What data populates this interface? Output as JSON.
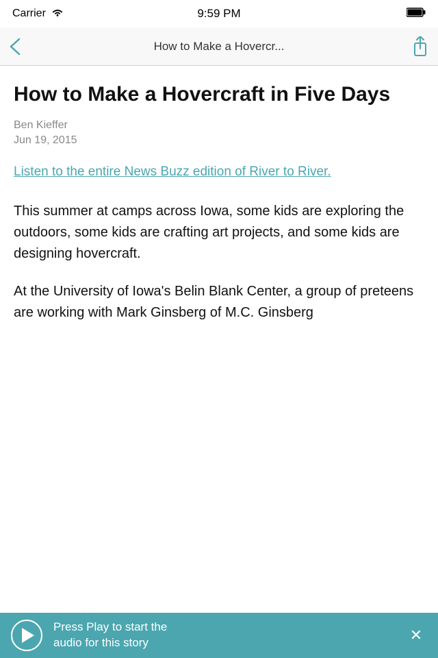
{
  "status_bar": {
    "carrier": "Carrier",
    "time": "9:59 PM"
  },
  "nav": {
    "title": "How to Make a Hovercr...",
    "back_label": "‹"
  },
  "article": {
    "title": "How to Make a Hovercraft in Five Days",
    "author": "Ben Kieffer",
    "date": "Jun 19, 2015",
    "link_text": "Listen to the entire News Buzz edition of River to River.",
    "body_paragraph_1": "This summer at camps across Iowa, some kids are exploring the outdoors, some kids are crafting art projects, and some kids are designing hovercraft.",
    "body_paragraph_2": "At the University of Iowa's Belin Blank Center, a group of preteens are working with Mark Ginsberg of M.C. Ginsberg"
  },
  "audio_bar": {
    "play_label": "▶",
    "text_line1": "Press Play to start the",
    "text_line2": "audio for this story",
    "close_label": "✕"
  }
}
